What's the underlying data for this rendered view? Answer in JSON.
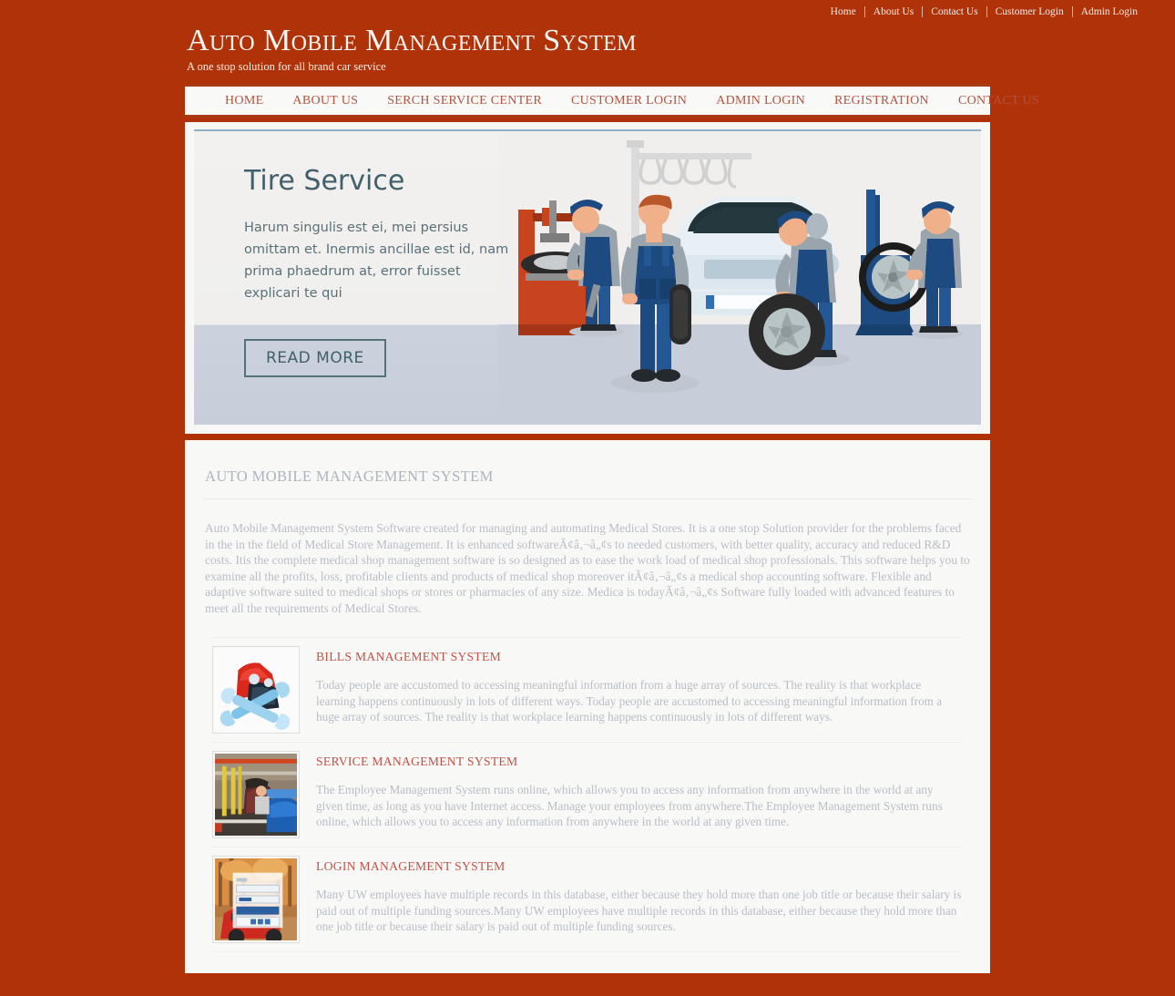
{
  "colors": {
    "brand_red": "#b03208",
    "nav_border": "#a83a16",
    "nav_link": "#b4533f",
    "block_heading": "#bf5248",
    "body_text": "#b9bec6",
    "banner_heading": "#41606b"
  },
  "top_links": [
    {
      "label": "Home"
    },
    {
      "label": "About Us"
    },
    {
      "label": "Contact Us"
    },
    {
      "label": "Customer Login"
    },
    {
      "label": "Admin Login"
    }
  ],
  "brand": {
    "title": "Auto Mobile Management System",
    "tagline": "A one stop solution for all brand car service"
  },
  "nav": [
    {
      "label": "HOME"
    },
    {
      "label": "ABOUT US"
    },
    {
      "label": "SERCH SERVICE CENTER"
    },
    {
      "label": "CUSTOMER LOGIN"
    },
    {
      "label": "ADMIN LOGIN"
    },
    {
      "label": "REGISTRATION"
    },
    {
      "label": "CONTACT US"
    }
  ],
  "banner": {
    "heading": "Tire Service",
    "paragraph": "Harum singulis est ei, mei persius omittam et. Inermis ancillae est id, nam prima phaedrum at, error fuisset explicari te qui",
    "read_more": "READ MORE",
    "illustration_name": "tire-service-mechanics-illustration"
  },
  "main": {
    "section_title": "AUTO MOBILE MANAGEMENT SYSTEM",
    "intro": "Auto Mobile Management System Software created for managing and automating Medical Stores. It is a one stop Solution provider for the problems faced in the in the field of Medical Store Management. It is enhanced softwareÃ¢â‚¬â„¢s to needed customers, with better quality, accuracy and reduced R&D costs. Itis the complete medical shop management software is so designed as to ease the work load of medical shop professionals. This software helps you to examine all the profits, loss, profitable clients and products of medical shop moreover itÃ¢â‚¬â„¢s a medical shop accounting software. Flexible and adaptive software suited to medical shops or stores or pharmacies of any size. Medica is todayÃ¢â‚¬â„¢s Software fully loaded with advanced features to meet all the requirements of Medical Stores.",
    "blocks": [
      {
        "heading": "BILLS MANAGEMENT SYSTEM",
        "text": "Today people are accustomed to accessing meaningful information from a huge array of sources. The reality is that workplace learning happens continuously in lots of different ways. Today people are accustomed to accessing meaningful information from a huge array of sources. The reality is that workplace learning happens continuously in lots of different ways.",
        "image_name": "red-car-with-wrenches-logo"
      },
      {
        "heading": "SERVICE MANAGEMENT SYSTEM",
        "text": "The Employee Management System runs online, which allows you to access any information from anywhere in the world at any given time, as long as you have Internet access. Manage your employees from anywhere.The Employee Management System runs online, which allows you to access any information from anywhere in the world at any given time.",
        "image_name": "car-assembly-line-photo"
      },
      {
        "heading": "LOGIN MANAGEMENT SYSTEM",
        "text": "Many UW employees have multiple records in this database, either because they hold more than one job title or because their salary is paid out of multiple funding sources.Many UW employees have multiple records in this database, either because they hold more than one job title or because their salary is paid out of multiple funding sources.",
        "image_name": "login-form-over-red-car-photo"
      }
    ]
  }
}
